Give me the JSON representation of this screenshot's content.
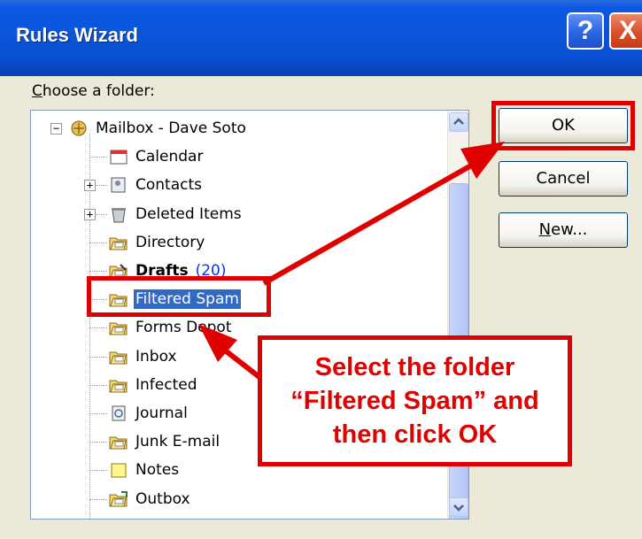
{
  "window": {
    "title": "Rules Wizard",
    "help_label": "?",
    "close_label": "X"
  },
  "prompt": {
    "label_prefix": "C",
    "label_rest": "hoose a folder:"
  },
  "tree": {
    "root": {
      "label": "Mailbox - Dave Soto",
      "icon": "mailbox-icon",
      "expander": "−"
    },
    "items": [
      {
        "label": "Calendar",
        "icon": "calendar-icon",
        "expander": ""
      },
      {
        "label": "Contacts",
        "icon": "contacts-icon",
        "expander": "+"
      },
      {
        "label": "Deleted Items",
        "icon": "trash-icon",
        "expander": "+"
      },
      {
        "label": "Directory",
        "icon": "folder-icon",
        "expander": ""
      },
      {
        "label": "Drafts",
        "count": "(20)",
        "icon": "drafts-icon",
        "expander": "",
        "bold": true
      },
      {
        "label": "Filtered Spam",
        "icon": "folder-icon",
        "expander": "",
        "selected": true
      },
      {
        "label": "Forms Depot",
        "icon": "folder-icon",
        "expander": ""
      },
      {
        "label": "Inbox",
        "icon": "inbox-icon",
        "expander": ""
      },
      {
        "label": "Infected",
        "icon": "folder-icon",
        "expander": ""
      },
      {
        "label": "Journal",
        "icon": "journal-icon",
        "expander": ""
      },
      {
        "label": "Junk E-mail",
        "icon": "folder-icon",
        "expander": ""
      },
      {
        "label": "Notes",
        "icon": "notes-icon",
        "expander": ""
      },
      {
        "label": "Outbox",
        "icon": "outbox-icon",
        "expander": ""
      }
    ]
  },
  "buttons": {
    "ok": "OK",
    "cancel": "Cancel",
    "new_prefix": "N",
    "new_rest": "ew..."
  },
  "annotation": {
    "callout": "Select the folder\n“Filtered Spam” and\nthen click OK",
    "color": "#e00000"
  }
}
